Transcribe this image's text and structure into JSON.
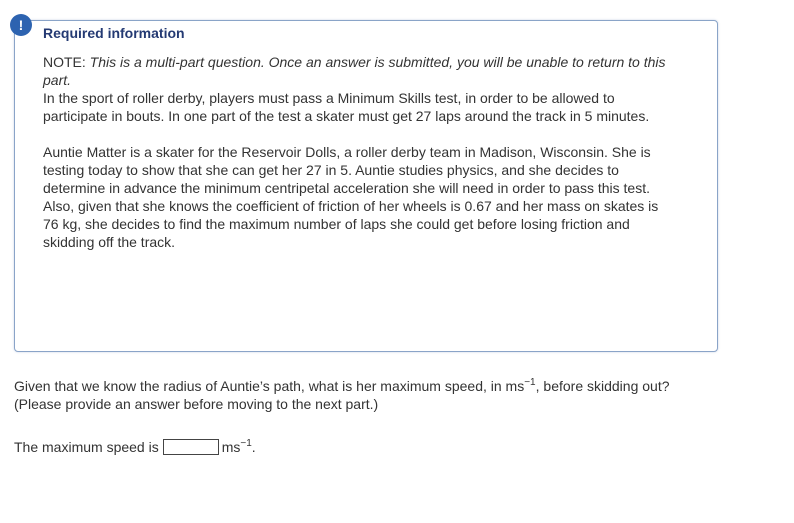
{
  "alert": {
    "icon_glyph": "!",
    "icon_name": "exclamation-icon",
    "color": "#2d63b0"
  },
  "info": {
    "title": "Required information",
    "note_label": "NOTE:",
    "note_text": "This is a multi-part question. Once an answer is submitted, you will be unable to return to this part.",
    "paragraph1": "In the sport of roller derby, players must pass a Minimum Skills test, in order to be allowed to participate in bouts. In one part of the test a skater must get 27 laps around the track in 5 minutes.",
    "paragraph2": "Auntie Matter is a skater for the Reservoir Dolls, a roller derby team in Madison, Wisconsin. She is testing today to show that she can get her 27 in 5. Auntie studies physics, and she decides to determine in advance the minimum centripetal acceleration she will need in order to pass this test. Also, given that she knows the coefficient of friction of her wheels is 0.67 and her mass on skates is 76 kg, she decides to find the maximum number of laps she could get before losing friction and skidding off the track.",
    "border_color": "#8aa4c8",
    "title_color": "#243a73"
  },
  "question": {
    "text_before_unit": "Given that we know the radius of Auntie’s path, what is her maximum speed, in ms",
    "unit_exponent": "−1",
    "text_after_unit": ", before skidding out?",
    "instruction": "(Please provide an answer before moving to the next part.)"
  },
  "answer": {
    "label": "The maximum speed is",
    "value": "",
    "unit_base": "ms",
    "unit_exponent": "−1",
    "unit_trailing": "."
  }
}
